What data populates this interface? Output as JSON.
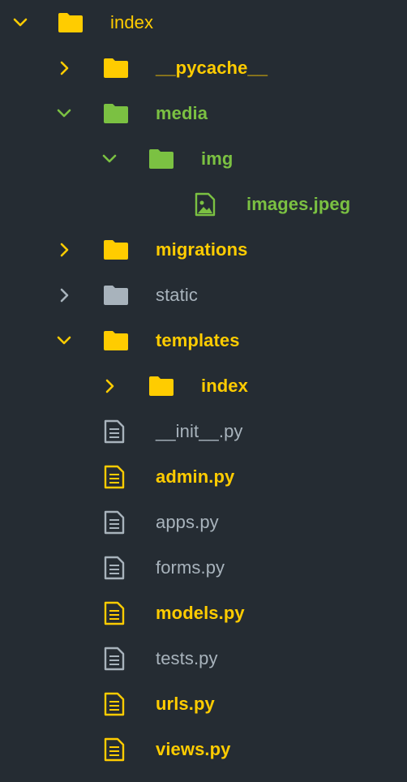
{
  "colors": {
    "background": "#252c33",
    "modified": "#ffcc00",
    "added": "#7bc142",
    "default": "#a8b3bc"
  },
  "tree": [
    {
      "label": "index",
      "type": "folder",
      "state": "expanded",
      "status": "modified"
    },
    {
      "label": "__pycache__",
      "type": "folder",
      "state": "collapsed",
      "status": "modified"
    },
    {
      "label": "media",
      "type": "folder",
      "state": "expanded",
      "status": "added"
    },
    {
      "label": "img",
      "type": "folder",
      "state": "expanded",
      "status": "added"
    },
    {
      "label": "images.jpeg",
      "type": "image-file",
      "state": "none",
      "status": "added"
    },
    {
      "label": "migrations",
      "type": "folder",
      "state": "collapsed",
      "status": "modified"
    },
    {
      "label": "static",
      "type": "folder",
      "state": "collapsed",
      "status": "default"
    },
    {
      "label": "templates",
      "type": "folder",
      "state": "expanded",
      "status": "modified"
    },
    {
      "label": "index",
      "type": "folder",
      "state": "collapsed",
      "status": "modified"
    },
    {
      "label": "__init__.py",
      "type": "file",
      "state": "none",
      "status": "default"
    },
    {
      "label": "admin.py",
      "type": "file",
      "state": "none",
      "status": "modified"
    },
    {
      "label": "apps.py",
      "type": "file",
      "state": "none",
      "status": "default"
    },
    {
      "label": "forms.py",
      "type": "file",
      "state": "none",
      "status": "default"
    },
    {
      "label": "models.py",
      "type": "file",
      "state": "none",
      "status": "modified"
    },
    {
      "label": "tests.py",
      "type": "file",
      "state": "none",
      "status": "default"
    },
    {
      "label": "urls.py",
      "type": "file",
      "state": "none",
      "status": "modified"
    },
    {
      "label": "views.py",
      "type": "file",
      "state": "none",
      "status": "modified"
    }
  ]
}
